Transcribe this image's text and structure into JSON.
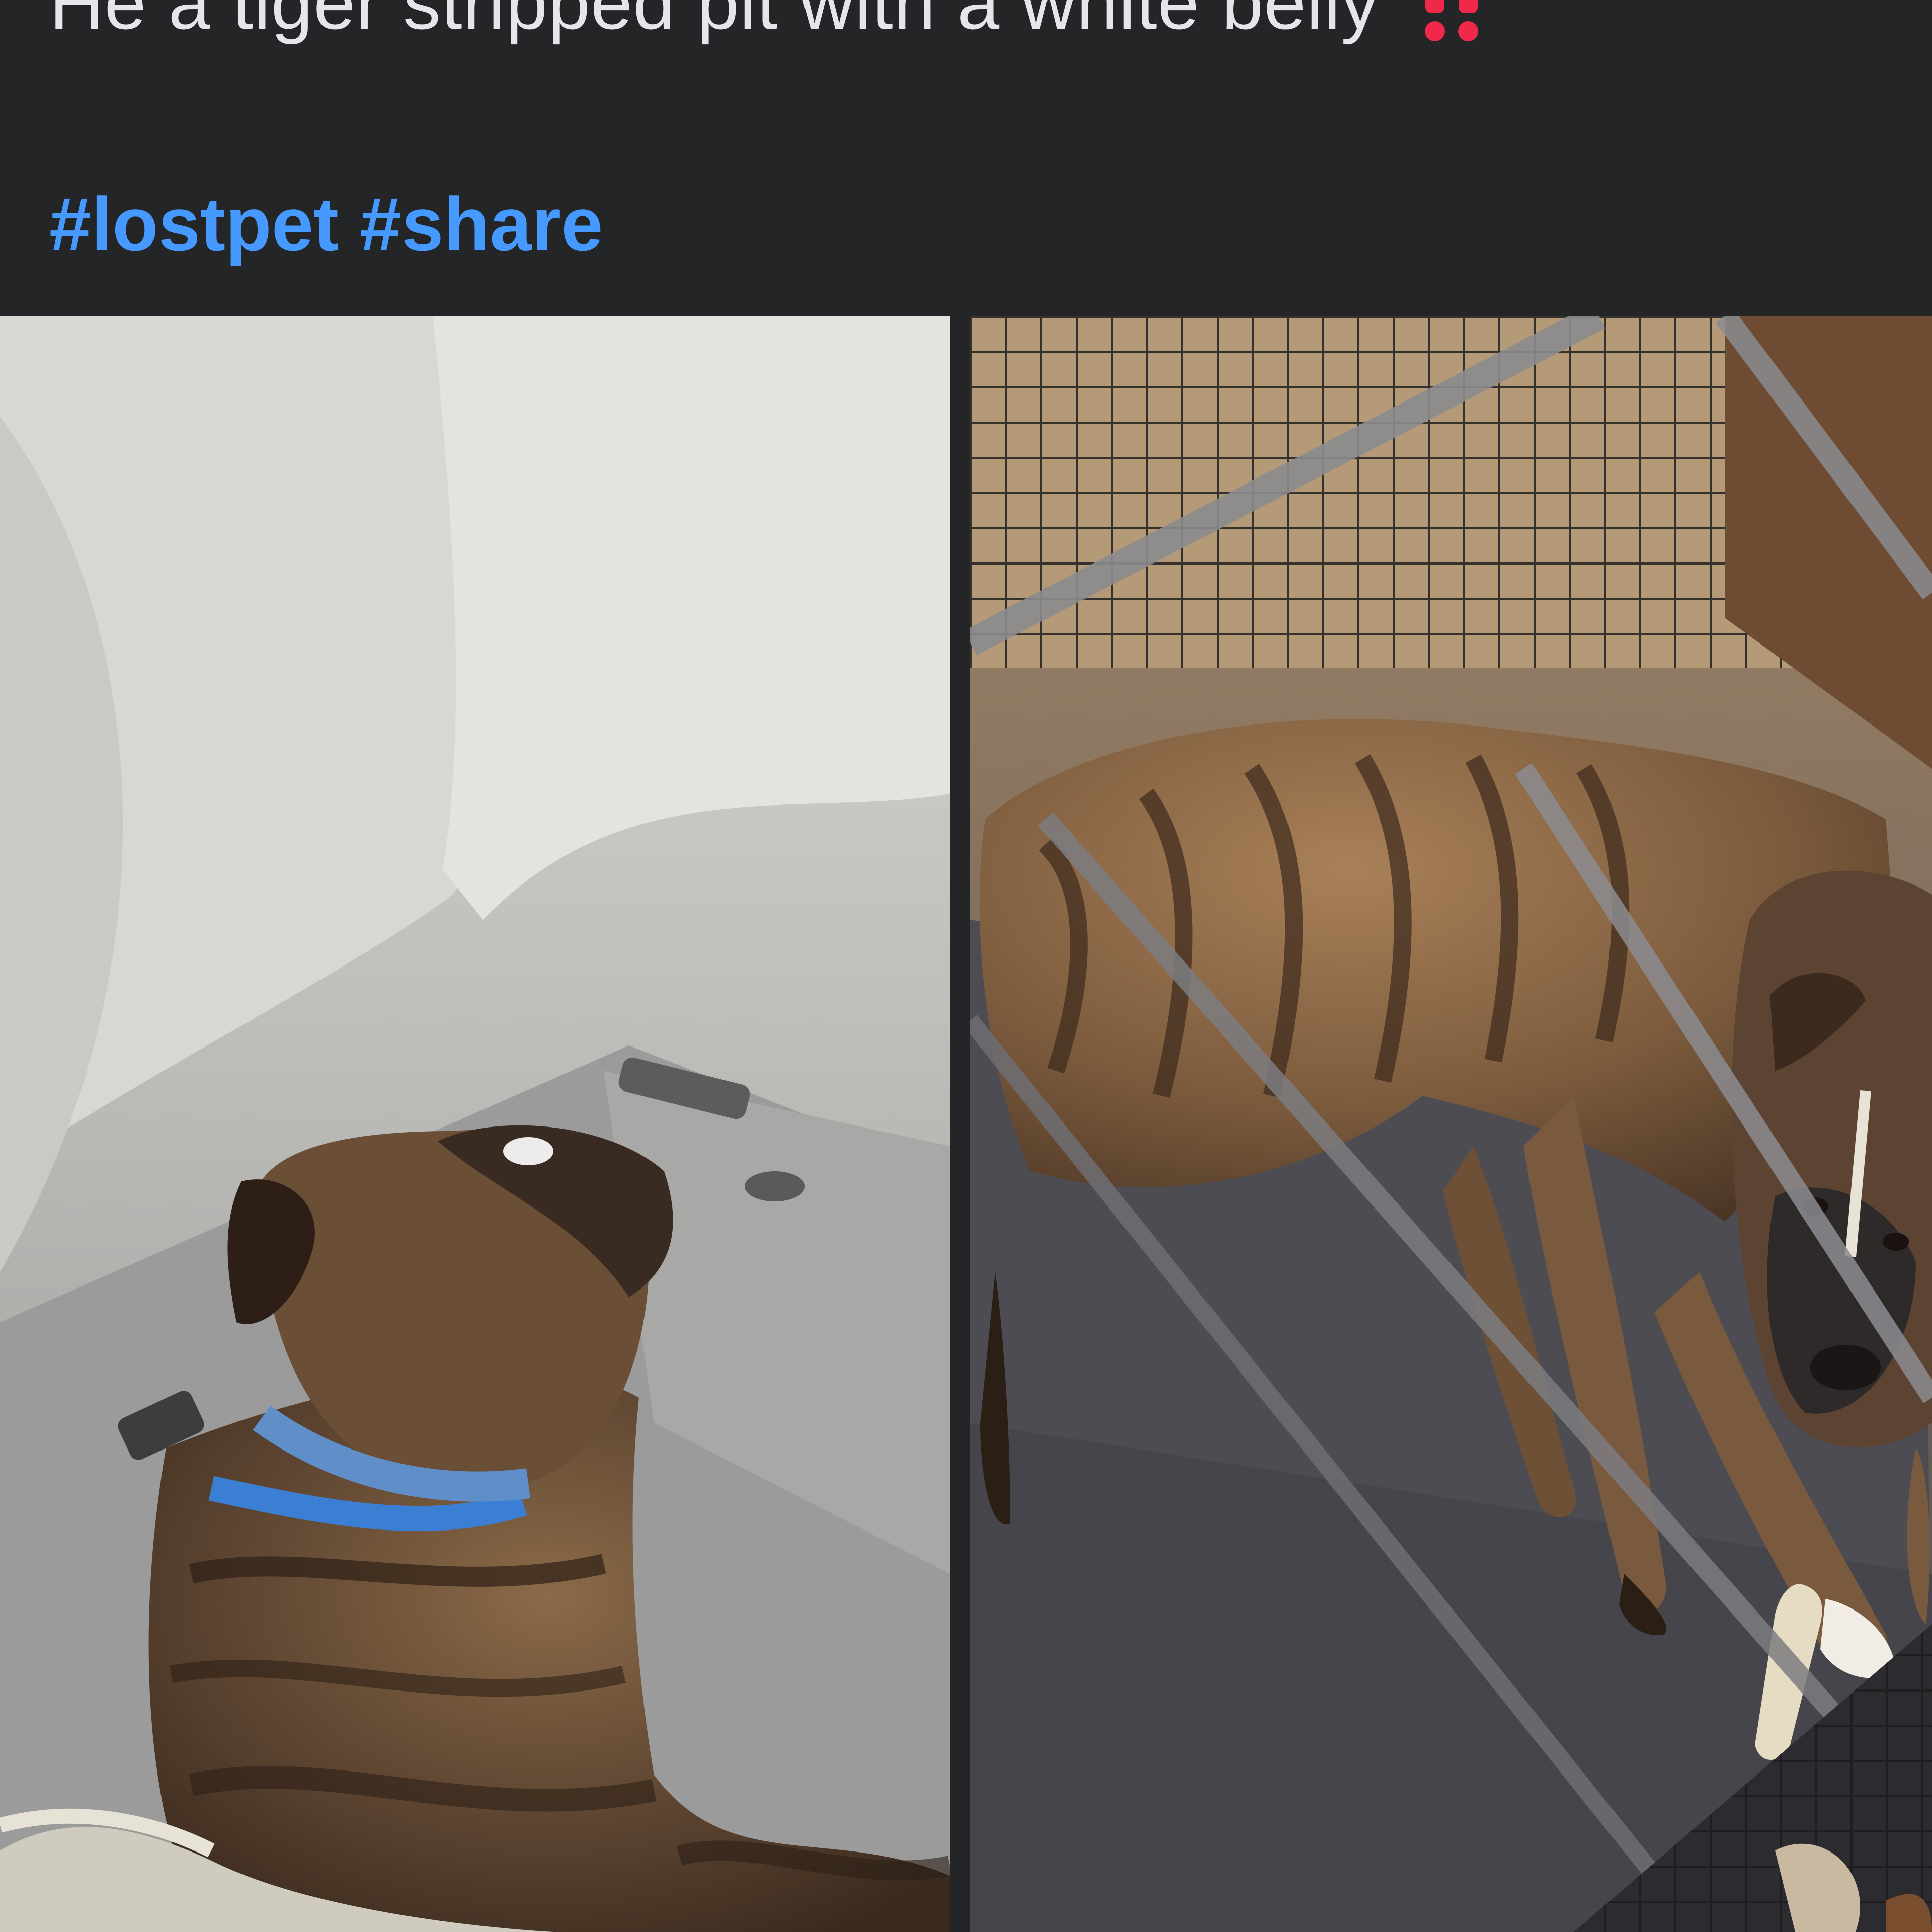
{
  "post": {
    "text": "He a tiger stripped pit with a white belly",
    "alert_icon": "double-exclamation-icon",
    "hashtags": [
      "#lostpet",
      "#share"
    ]
  },
  "photos": [
    {
      "subject": "brindle dog in car back seat"
    },
    {
      "subject": "brindle dog lying in crate"
    }
  ],
  "colors": {
    "background": "#242526",
    "text": "#e4e6eb",
    "hashtag": "#4599ff",
    "alert": "#f02849"
  }
}
